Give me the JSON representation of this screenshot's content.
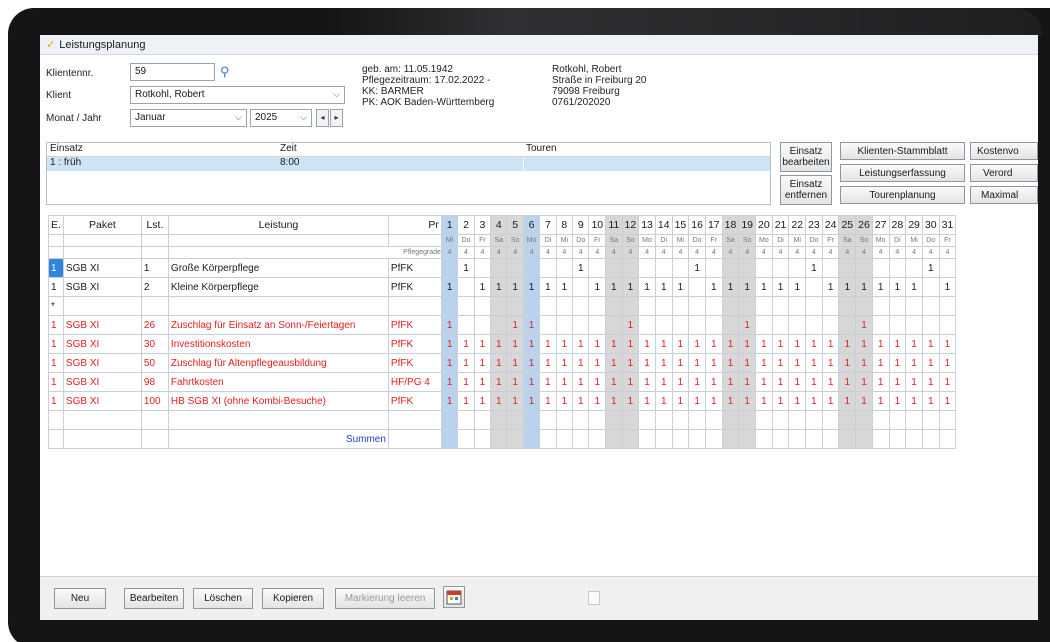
{
  "window": {
    "title": "Leistungsplanung"
  },
  "client": {
    "nr_label": "Klientennr.",
    "nr_value": "59",
    "client_label": "Klient",
    "client_value": "Rotkohl, Robert",
    "month_label": "Monat / Jahr",
    "month_value": "Januar",
    "year_value": "2025"
  },
  "info": {
    "birth": "geb. am:  11.05.1942",
    "period": "Pflegezeitraum: 17.02.2022 -",
    "kk": "KK:  BARMER",
    "pk": "PK:  AOK Baden-Württemberg",
    "name": "Rotkohl, Robert",
    "street": "Straße in Freiburg 20",
    "city": "79098    Freiburg",
    "phone": "0761/202020"
  },
  "einsatz": {
    "headers": [
      "Einsatz",
      "Zeit",
      "Touren"
    ],
    "row": {
      "einsatz": "1 : früh",
      "zeit": "8:00",
      "touren": ""
    }
  },
  "side_buttons": {
    "edit": "Einsatz bearbeiten",
    "remove": "Einsatz entfernen",
    "stammblatt": "Klienten-Stammblatt",
    "kosten": "Kostenvo",
    "erfassung": "Leistungserfassung",
    "verord": "Verord",
    "touren": "Tourenplanung",
    "maximal": "Maximal"
  },
  "grid": {
    "headers": {
      "e": "E.",
      "paket": "Paket",
      "lst": "Lst.",
      "leistung": "Leistung",
      "pr": "Pr"
    },
    "pflegegrade": "Pflegegrade",
    "days": [
      "1",
      "2",
      "3",
      "4",
      "5",
      "6",
      "7",
      "8",
      "9",
      "10",
      "11",
      "12",
      "13",
      "14",
      "15",
      "16",
      "17",
      "18",
      "19",
      "20",
      "21",
      "22",
      "23",
      "24",
      "25",
      "26",
      "27",
      "28",
      "29",
      "30",
      "31"
    ],
    "weekdays": [
      "Mi",
      "Do",
      "Fr",
      "Sa",
      "So",
      "Mo",
      "Di",
      "Mi",
      "Do",
      "Fr",
      "Sa",
      "So",
      "Mo",
      "Di",
      "Mi",
      "Do",
      "Fr",
      "Sa",
      "So",
      "Mo",
      "Di",
      "Mi",
      "Do",
      "Fr",
      "Sa",
      "So",
      "Mo",
      "Di",
      "Mi",
      "Do",
      "Fr"
    ],
    "grades": [
      "4",
      "4",
      "4",
      "4",
      "4",
      "4",
      "4",
      "4",
      "4",
      "4",
      "4",
      "4",
      "4",
      "4",
      "4",
      "4",
      "4",
      "4",
      "4",
      "4",
      "4",
      "4",
      "4",
      "4",
      "4",
      "4",
      "4",
      "4",
      "4",
      "4",
      "4"
    ],
    "rows": [
      {
        "e": "1",
        "paket": "SGB XI",
        "lst": "1",
        "leistung": "Große Körperpflege",
        "pr": "PfFK",
        "red": false,
        "cells": [
          "",
          "1",
          "",
          "",
          "",
          "",
          "",
          "",
          "1",
          "",
          "",
          "",
          "",
          "",
          "",
          "1",
          "",
          "",
          "",
          "",
          "",
          "",
          "1",
          "",
          "",
          "",
          "",
          "",
          "",
          "1",
          ""
        ]
      },
      {
        "e": "1",
        "paket": "SGB XI",
        "lst": "2",
        "leistung": "Kleine Körperpflege",
        "pr": "PfFK",
        "red": false,
        "cells": [
          "1",
          "",
          "1",
          "1",
          "1",
          "1",
          "1",
          "1",
          "",
          "1",
          "1",
          "1",
          "1",
          "1",
          "1",
          "",
          "1",
          "1",
          "1",
          "1",
          "1",
          "1",
          "",
          "1",
          "1",
          "1",
          "1",
          "1",
          "1",
          "",
          "1"
        ]
      },
      {
        "e": "*",
        "paket": "",
        "lst": "",
        "leistung": "",
        "pr": "",
        "red": false,
        "cells": [
          "",
          "",
          "",
          "",
          "",
          "",
          "",
          "",
          "",
          "",
          "",
          "",
          "",
          "",
          "",
          "",
          "",
          "",
          "",
          "",
          "",
          "",
          "",
          "",
          "",
          "",
          "",
          "",
          "",
          "",
          ""
        ]
      },
      {
        "e": "1",
        "paket": "SGB XI",
        "lst": "26",
        "leistung": "Zuschlag für Einsatz an Sonn-/Feiertagen",
        "pr": "PfFK",
        "red": true,
        "cells": [
          "1",
          "",
          "",
          "",
          "1",
          "1",
          "",
          "",
          "",
          "",
          "",
          "1",
          "",
          "",
          "",
          "",
          "",
          "",
          "1",
          "",
          "",
          "",
          "",
          "",
          "",
          "1",
          "",
          "",
          "",
          "",
          ""
        ]
      },
      {
        "e": "1",
        "paket": "SGB XI",
        "lst": "30",
        "leistung": "Investitionskosten",
        "pr": "PfFK",
        "red": true,
        "cells": [
          "1",
          "1",
          "1",
          "1",
          "1",
          "1",
          "1",
          "1",
          "1",
          "1",
          "1",
          "1",
          "1",
          "1",
          "1",
          "1",
          "1",
          "1",
          "1",
          "1",
          "1",
          "1",
          "1",
          "1",
          "1",
          "1",
          "1",
          "1",
          "1",
          "1",
          "1"
        ]
      },
      {
        "e": "1",
        "paket": "SGB XI",
        "lst": "50",
        "leistung": "Zuschlag für Altenpflegeausbildung",
        "pr": "PfFK",
        "red": true,
        "cells": [
          "1",
          "1",
          "1",
          "1",
          "1",
          "1",
          "1",
          "1",
          "1",
          "1",
          "1",
          "1",
          "1",
          "1",
          "1",
          "1",
          "1",
          "1",
          "1",
          "1",
          "1",
          "1",
          "1",
          "1",
          "1",
          "1",
          "1",
          "1",
          "1",
          "1",
          "1"
        ]
      },
      {
        "e": "1",
        "paket": "SGB XI",
        "lst": "98",
        "leistung": "Fahrtkosten",
        "pr": "HF/PG 4",
        "red": true,
        "cells": [
          "1",
          "1",
          "1",
          "1",
          "1",
          "1",
          "1",
          "1",
          "1",
          "1",
          "1",
          "1",
          "1",
          "1",
          "1",
          "1",
          "1",
          "1",
          "1",
          "1",
          "1",
          "1",
          "1",
          "1",
          "1",
          "1",
          "1",
          "1",
          "1",
          "1",
          "1"
        ]
      },
      {
        "e": "1",
        "paket": "SGB XI",
        "lst": "100",
        "leistung": "HB SGB XI (ohne Kombi-Besuche)",
        "pr": "PfFK",
        "red": true,
        "cells": [
          "1",
          "1",
          "1",
          "1",
          "1",
          "1",
          "1",
          "1",
          "1",
          "1",
          "1",
          "1",
          "1",
          "1",
          "1",
          "1",
          "1",
          "1",
          "1",
          "1",
          "1",
          "1",
          "1",
          "1",
          "1",
          "1",
          "1",
          "1",
          "1",
          "1",
          "1"
        ]
      }
    ],
    "summen": "Summen"
  },
  "bottom_buttons": {
    "neu": "Neu",
    "bearbeiten": "Bearbeiten",
    "loeschen": "Löschen",
    "kopieren": "Kopieren",
    "markierung": "Markierung leeren"
  }
}
